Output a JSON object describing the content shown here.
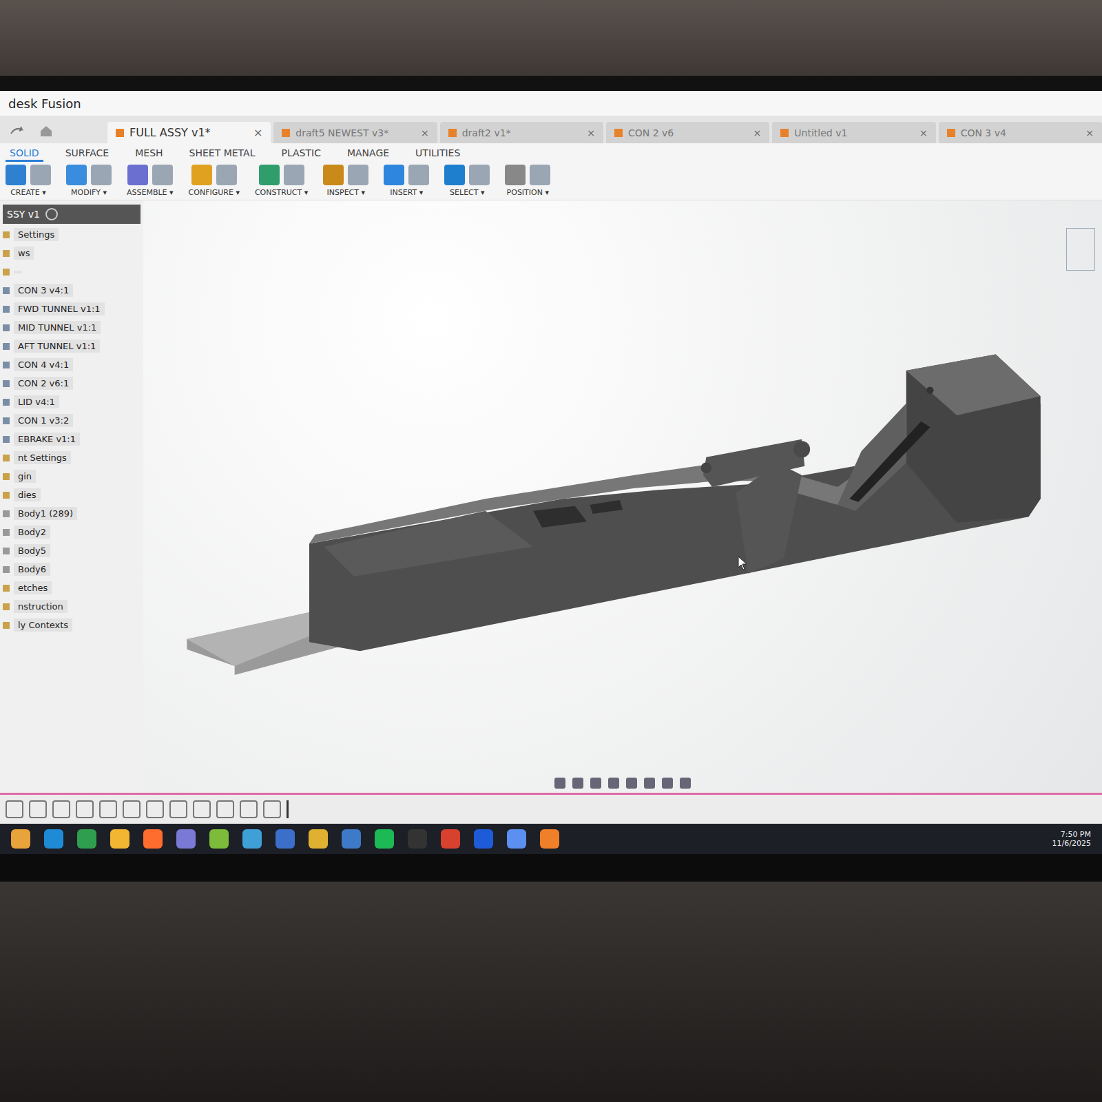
{
  "window": {
    "title": "desk Fusion"
  },
  "workspace_tabs": [
    {
      "label": "SOLID",
      "selected": true
    },
    {
      "label": "SURFACE",
      "selected": false
    },
    {
      "label": "MESH",
      "selected": false
    },
    {
      "label": "SHEET METAL",
      "selected": false
    },
    {
      "label": "PLASTIC",
      "selected": false
    },
    {
      "label": "MANAGE",
      "selected": false
    },
    {
      "label": "UTILITIES",
      "selected": false
    }
  ],
  "document_tabs": [
    {
      "label": "FULL ASSY v1*",
      "selected": true,
      "close": "×"
    },
    {
      "label": "draft5 NEWEST v3*",
      "selected": false,
      "close": "×"
    },
    {
      "label": "draft2 v1*",
      "selected": false,
      "close": "×"
    },
    {
      "label": "CON 2 v6",
      "selected": false,
      "close": "×"
    },
    {
      "label": "Untitled v1",
      "selected": false,
      "close": "×"
    },
    {
      "label": "CON 3 v4",
      "selected": false,
      "close": "×"
    }
  ],
  "toolbar_groups": [
    {
      "label": "CREATE ▾"
    },
    {
      "label": "MODIFY ▾"
    },
    {
      "label": "ASSEMBLE ▾"
    },
    {
      "label": "CONFIGURE ▾"
    },
    {
      "label": "CONSTRUCT ▾"
    },
    {
      "label": "INSPECT ▾"
    },
    {
      "label": "INSERT ▾"
    },
    {
      "label": "SELECT ▾"
    },
    {
      "label": "POSITION ▾"
    }
  ],
  "browser": {
    "root": "SSY v1",
    "items": [
      {
        "label": "Settings",
        "kind": "folder"
      },
      {
        "label": "ws",
        "kind": "folder"
      },
      {
        "label": "",
        "kind": "folder"
      },
      {
        "label": "CON 3 v4:1",
        "kind": "component"
      },
      {
        "label": "FWD TUNNEL v1:1",
        "kind": "component"
      },
      {
        "label": "MID TUNNEL v1:1",
        "kind": "component"
      },
      {
        "label": "AFT TUNNEL v1:1",
        "kind": "component"
      },
      {
        "label": "CON 4 v4:1",
        "kind": "component"
      },
      {
        "label": "CON 2 v6:1",
        "kind": "component"
      },
      {
        "label": "LID v4:1",
        "kind": "component"
      },
      {
        "label": "CON 1 v3:2",
        "kind": "component"
      },
      {
        "label": "EBRAKE v1:1",
        "kind": "component"
      },
      {
        "label": "nt Settings",
        "kind": "folder"
      },
      {
        "label": "gin",
        "kind": "folder"
      },
      {
        "label": "dies",
        "kind": "folder"
      },
      {
        "label": "Body1 (289)",
        "kind": "body"
      },
      {
        "label": "Body2",
        "kind": "body"
      },
      {
        "label": "Body5",
        "kind": "body"
      },
      {
        "label": "Body6",
        "kind": "body"
      },
      {
        "label": "etches",
        "kind": "folder"
      },
      {
        "label": "nstruction",
        "kind": "folder"
      },
      {
        "label": "ly Contexts",
        "kind": "folder"
      }
    ]
  },
  "taskbar": {
    "time": "7:50 PM",
    "date": "11/6/2025"
  }
}
